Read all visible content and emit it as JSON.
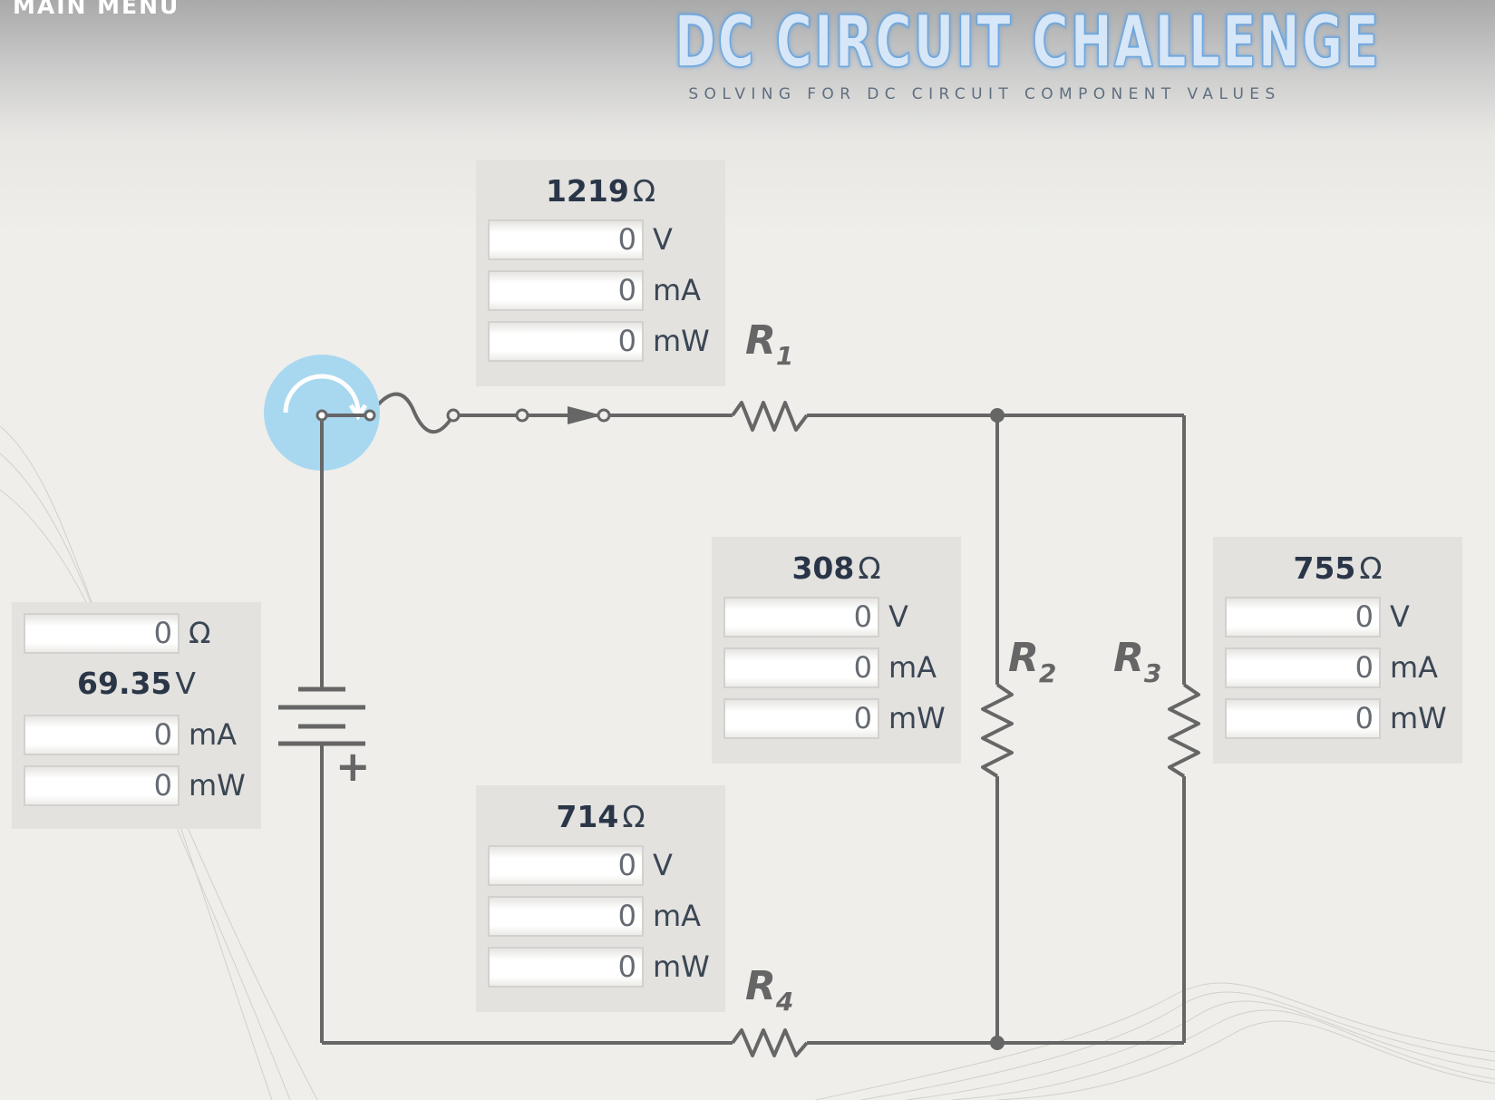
{
  "menu": {
    "label": "MAIN MENU"
  },
  "header": {
    "title": "DC CIRCUIT CHALLENGE",
    "subtitle": "SOLVING FOR DC CIRCUIT COMPONENT VALUES"
  },
  "colors": {
    "accent": "#a8d8f0",
    "wire": "#666666",
    "panel": "#e3e2df"
  },
  "switch": {
    "icon": "rotate-switch-icon"
  },
  "r1": {
    "label": "R",
    "sub": "1",
    "resistance": "1219",
    "resistance_unit": "Ω",
    "voltage": "0",
    "voltage_unit": "V",
    "current": "0",
    "current_unit": "mA",
    "power": "0",
    "power_unit": "mW"
  },
  "r2": {
    "label": "R",
    "sub": "2",
    "resistance": "308",
    "resistance_unit": "Ω",
    "voltage": "0",
    "voltage_unit": "V",
    "current": "0",
    "current_unit": "mA",
    "power": "0",
    "power_unit": "mW"
  },
  "r3": {
    "label": "R",
    "sub": "3",
    "resistance": "755",
    "resistance_unit": "Ω",
    "voltage": "0",
    "voltage_unit": "V",
    "current": "0",
    "current_unit": "mA",
    "power": "0",
    "power_unit": "mW"
  },
  "r4": {
    "label": "R",
    "sub": "4",
    "resistance": "714",
    "resistance_unit": "Ω",
    "voltage": "0",
    "voltage_unit": "V",
    "current": "0",
    "current_unit": "mA",
    "power": "0",
    "power_unit": "mW"
  },
  "source": {
    "resistance": "0",
    "resistance_unit": "Ω",
    "voltage": "69.35",
    "voltage_unit": "V",
    "current": "0",
    "current_unit": "mA",
    "power": "0",
    "power_unit": "mW",
    "plus": "+"
  }
}
